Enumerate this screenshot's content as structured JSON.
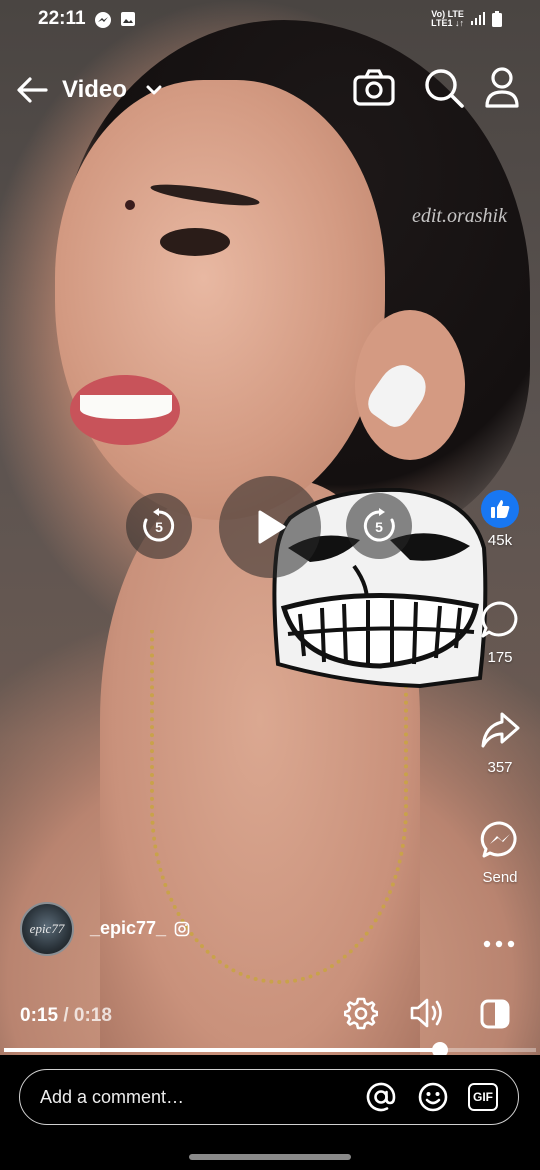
{
  "status_bar": {
    "time": "22:11",
    "network_top": "Vo) LTE",
    "network_bottom": "LTE1 ↓↑"
  },
  "header": {
    "back_icon": "arrow-left-icon",
    "title": "Video",
    "dropdown_icon": "chevron-down-icon",
    "camera_icon": "camera-icon",
    "search_icon": "search-icon",
    "profile_icon": "person-icon"
  },
  "video": {
    "watermark": "edit.orashik"
  },
  "player": {
    "rewind_seconds": "5",
    "forward_seconds": "5",
    "play_icon": "play-icon",
    "current_time": "0:15",
    "separator": "/",
    "total_time": "0:18",
    "progress": 0.82
  },
  "actions": {
    "like_count": "45k",
    "comment_count": "175",
    "share_count": "357",
    "send_label": "Send"
  },
  "author": {
    "avatar_text": "epic77",
    "name": "_epic77_"
  },
  "comment": {
    "placeholder": "Add a comment…",
    "gif_label": "GIF"
  },
  "colors": {
    "like_blue": "#1877f2",
    "background": "#000000"
  }
}
